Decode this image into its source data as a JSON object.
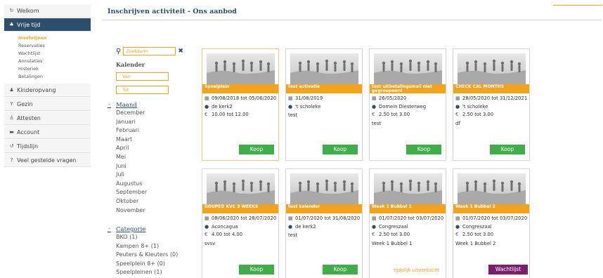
{
  "sidebar": {
    "items": [
      {
        "label": "Welkom",
        "icon": "welcome-icon"
      },
      {
        "label": "Vrije tijd",
        "icon": "leisure-icon"
      },
      {
        "label": "Kinderopvang",
        "icon": "childcare-icon"
      },
      {
        "label": "Gezin",
        "icon": "family-icon"
      },
      {
        "label": "Attesten",
        "icon": "certificate-icon"
      },
      {
        "label": "Account",
        "icon": "account-icon"
      },
      {
        "label": "Tijdslijn",
        "icon": "timeline-icon"
      },
      {
        "label": "Veel gestelde vragen",
        "icon": "question-icon"
      }
    ],
    "subitems": [
      "Inschrijven",
      "Reservaties",
      "Wachtlijst",
      "Annulaties",
      "Historiek",
      "Betalingen"
    ]
  },
  "page": {
    "title": "Inschrijven activiteit - Ons aanbod"
  },
  "filters": {
    "search_placeholder": "Zoekterm",
    "kalender_title": "Kalender",
    "van_placeholder": "Van",
    "tot_placeholder": "Tot",
    "maand": {
      "title": "Maand",
      "items": [
        "December",
        "Januari",
        "Februari",
        "Maart",
        "April",
        "Mei",
        "Juni",
        "Juli",
        "Augustus",
        "September",
        "Oktober",
        "November"
      ]
    },
    "categorie": {
      "title": "Categorie",
      "items": [
        "BKO (1)",
        "Kampen 8+ (1)",
        "Peuters & Kleuters (0)",
        "Speelplein 8+ (0)",
        "Speelpleinen (1)"
      ]
    }
  },
  "cards": [
    {
      "title": "Speelplein",
      "date": "09/08/2018 tot 05/06/2020",
      "location": "de kerk2",
      "price": "10.00 tot 12.00",
      "desc": "",
      "action": "Koop",
      "action_type": "koop"
    },
    {
      "title": "test activatie",
      "date": "31/08/2019",
      "location": "'t scholeke",
      "price": "",
      "desc": "test",
      "action": "Koop",
      "action_type": "koop"
    },
    {
      "title": "test uitbetalingsmail niet gegroepeerd",
      "date": "26/05/2020",
      "location": "Domein Diesterweg",
      "price": "2.50 tot 3.00",
      "desc": "test",
      "action": "Koop",
      "action_type": "koop"
    },
    {
      "title": "CHECK CAL MONTHS",
      "date": "28/05/2020 tot 31/12/2021",
      "location": "'t scholeke",
      "price": "2.50 tot 3.00",
      "desc": "df",
      "action": "Koop",
      "action_type": "koop"
    },
    {
      "title": "GOUPED KVC 3 WEEKS",
      "date": "08/06/2020 tot 28/07/2020",
      "location": "Aconcagua",
      "price": "4.00 tot 4.00",
      "desc": "svsv",
      "action": "Koop",
      "action_type": "koop"
    },
    {
      "title": "test kalender",
      "date": "01/07/2020 tot 31/08/2020",
      "location": "de kerk2",
      "price": "",
      "desc": "test",
      "action": "Koop",
      "action_type": "koop"
    },
    {
      "title": "Week 1 Bubbel 1",
      "date": "01/07/2020 tot 03/07/2020",
      "location": "Congreszaal",
      "price": "2.50 tot 3.00",
      "desc": "Week 1 Bubbel 1",
      "action": "tijdelijk uitverkocht",
      "action_type": "sold"
    },
    {
      "title": "Week 1 Bubbel 2",
      "date": "01/07/2020 tot 03/07/2020",
      "location": "Congreszaal",
      "price": "2.50 tot 3.00",
      "desc": "Week 1 Bubbel 2",
      "action": "Wachtlijst",
      "action_type": "wachtlijst"
    }
  ],
  "symbols": {
    "euro": "€"
  },
  "colors": {
    "accent": "#f5a21b",
    "primary": "#2e4f6b",
    "buy": "#3fae49",
    "waitlist": "#7b1e6f"
  }
}
